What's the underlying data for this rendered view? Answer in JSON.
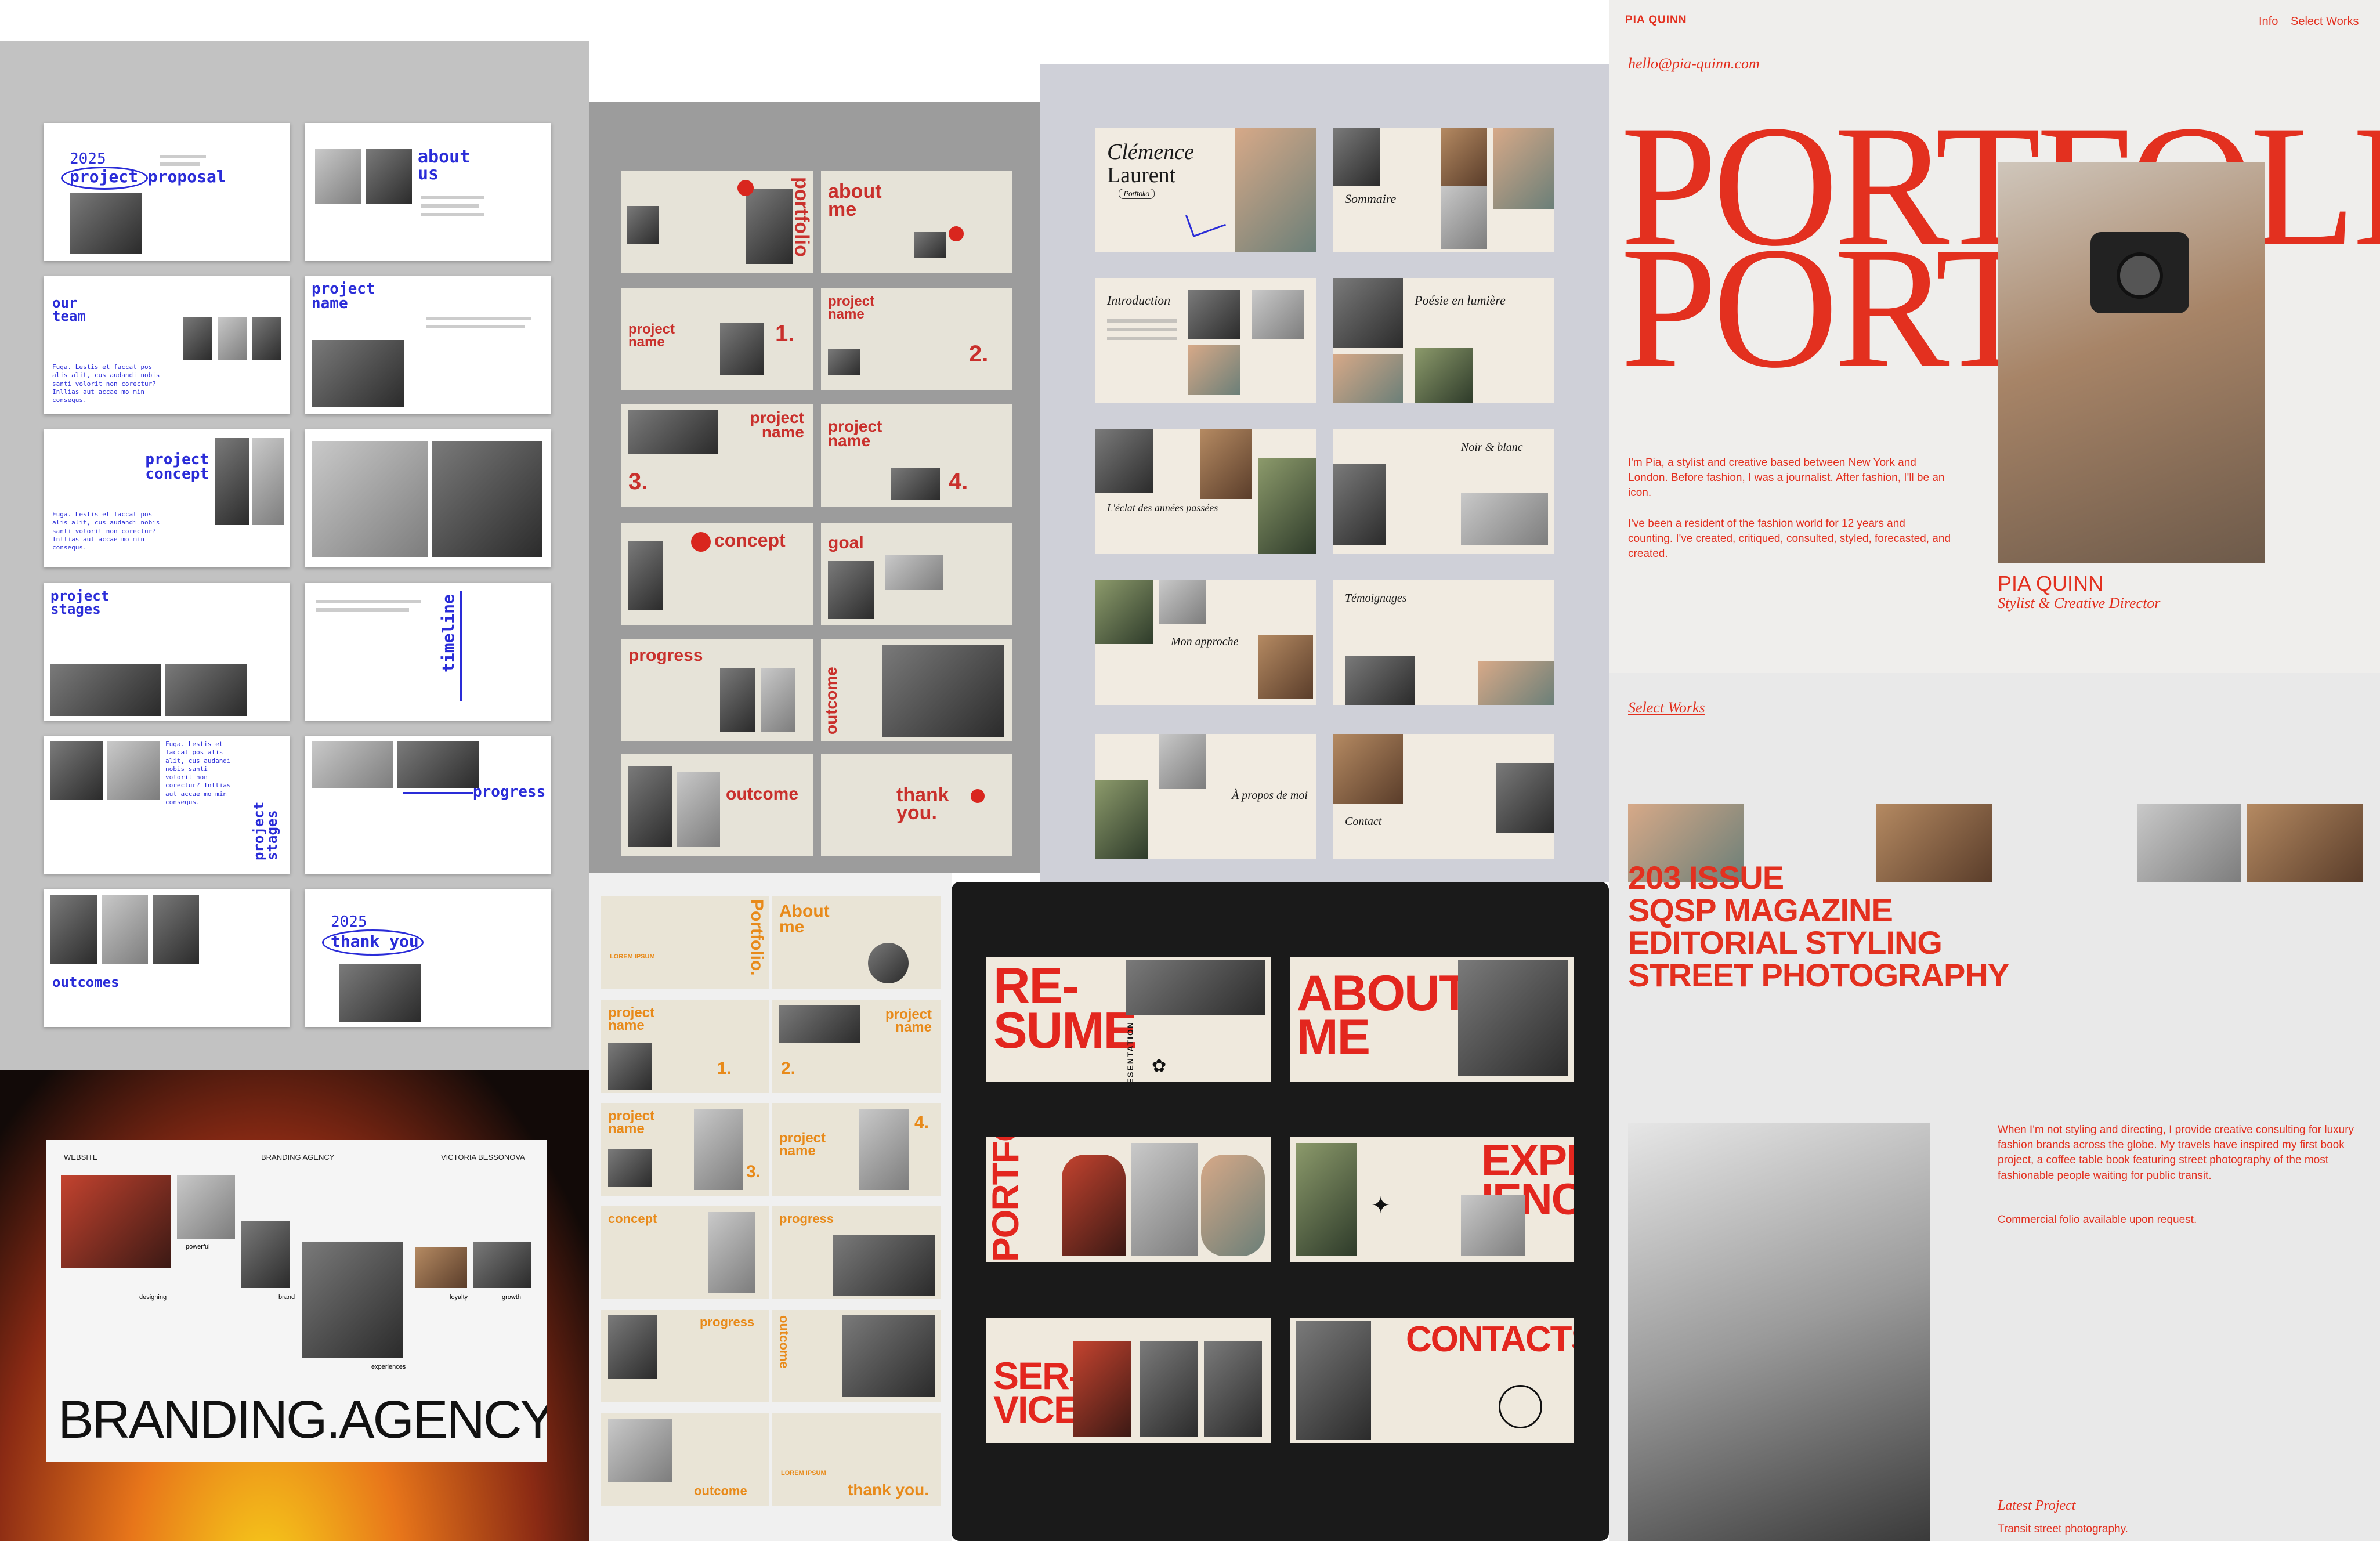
{
  "colors": {
    "p1_blue": "#2a2cd8",
    "p2_red": "#c9302c",
    "p5_orange": "#e88a1a",
    "p6_red": "#e3261e",
    "p7_red": "#e3301f"
  },
  "panel_project_proposal": {
    "title_2025": "2025",
    "title": "project proposal",
    "about": "about us",
    "our_team": "our team",
    "project_name": "project name",
    "project_concept": "project concept",
    "project_stages": "project stages",
    "timeline": "timeline",
    "progress": "progress",
    "outcomes": "outcomes",
    "thank_2025": "2025",
    "thank_you": "thank you",
    "body_text": "Fuga. Lestis et faccat pos alis alit, cus audandi nobis santi volorit non corectur? Inllias aut accae mo min consequs."
  },
  "panel_portfolio_red": {
    "portfolio": "portfolio",
    "about_me": "about me",
    "project_name": "project name",
    "n1": "1.",
    "n2": "2.",
    "n3": "3.",
    "n4": "4.",
    "concept": "concept",
    "goal": "goal",
    "progress": "progress",
    "outcome": "outcome",
    "thank_you": "thank you."
  },
  "panel_clemence": {
    "name_line1": "Clémence",
    "name_line2": "Laurent",
    "tag": "Portfolio",
    "sommaire": "Sommaire",
    "introduction": "Introduction",
    "poesie": "Poésie en lumière",
    "eclat": "L'éclat des années passées",
    "noir": "Noir & blanc",
    "approche": "Mon approche",
    "temoignages": "Témoignages",
    "apropos": "À propos de moi",
    "contact": "Contact"
  },
  "panel_branding": {
    "website": "WEBSITE",
    "agency": "BRANDING  AGENCY",
    "author": "VICTORIA BESSONOVA",
    "powerful": "powerful",
    "designing": "designing",
    "brand": "brand",
    "loyalty": "loyalty",
    "growth": "growth",
    "experiences": "experiences",
    "headline": "BRANDING.AGENCY"
  },
  "panel_portfolio_orange": {
    "portfolio": "Portfolio.",
    "about": "About me",
    "name": "LOREM IPSUM",
    "project_name": "project name",
    "n1": "1.",
    "n2": "2.",
    "n3": "3.",
    "n4": "4.",
    "concept": "concept",
    "progress": "progress",
    "outcome": "outcome",
    "thank_you": "thank you."
  },
  "panel_resume": {
    "resume": "RE- SUME",
    "presentation": "PRESENTATION",
    "about": "ABOUT ME",
    "portfolio": "PORTFOLIO",
    "experience": "EXPER IENCE",
    "services": "SER- VICES",
    "contacts": "CONTACTS"
  },
  "panel_pia_quinn": {
    "brand": "PIA QUINN",
    "nav_info": "Info",
    "nav_works": "Select Works",
    "email": "hello@pia-quinn.com",
    "hero_line1": "PORTFOLIO",
    "hero_line2": "PORTI",
    "bio1": "I'm Pia, a stylist and creative based between New York and London. Before fashion, I was a journalist. After fashion, I'll be an icon.",
    "bio2": "I've been a resident of the fashion world for 12 years and counting. I've created, critiqued, consulted, styled, forecasted, and created.",
    "name": "PIA QUINN",
    "role": "Stylist & Creative Director",
    "select_works": "Select Works",
    "works": [
      "203 ISSUE",
      "SQSP MAGAZINE",
      "EDITORIAL STYLING",
      "STREET PHOTOGRAPHY"
    ],
    "consulting": "When I'm not styling and directing, I provide creative consulting for luxury fashion brands across the globe. My travels have inspired my first book project, a coffee table book featuring street photography of the most fashionable people waiting for public transit.",
    "commercial": "Commercial folio available upon request.",
    "latest": "Latest Project",
    "latest_desc": "Transit street photography."
  }
}
